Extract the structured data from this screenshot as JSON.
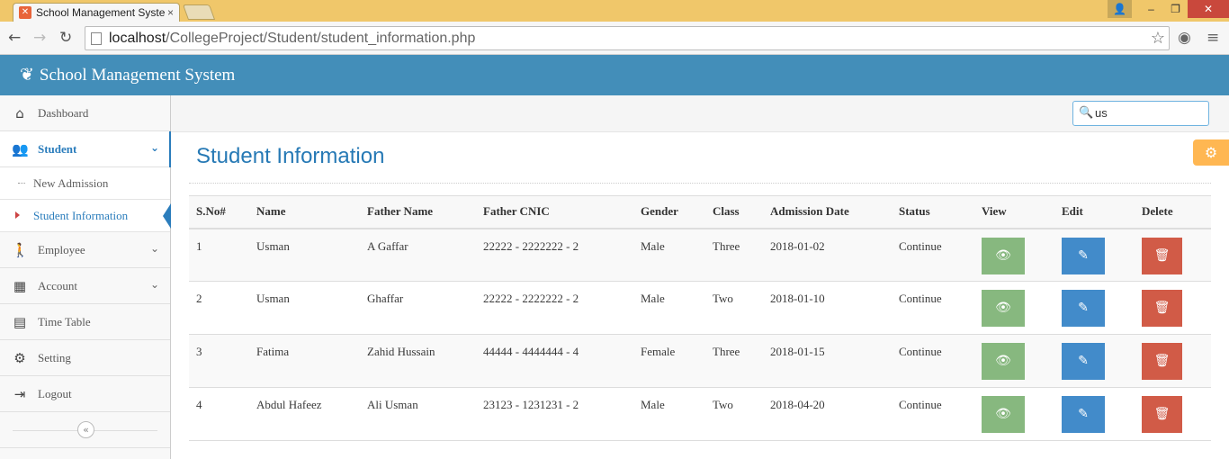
{
  "browser": {
    "tab_title": "School Management Syste",
    "tab_close": "×",
    "url_host": "localhost",
    "url_path": "/CollegeProject/Student/student_information.php"
  },
  "app": {
    "brand": "School Management System"
  },
  "sidebar": {
    "items": [
      {
        "label": "Dashboard",
        "icon": "home-icon"
      },
      {
        "label": "Student",
        "icon": "users-icon",
        "active": true
      },
      {
        "label": "Employee",
        "icon": "employee-icon"
      },
      {
        "label": "Account",
        "icon": "calculator-icon"
      },
      {
        "label": "Time Table",
        "icon": "calendar-icon"
      },
      {
        "label": "Setting",
        "icon": "cog-icon"
      },
      {
        "label": "Logout",
        "icon": "logout-icon"
      }
    ],
    "student_sub": [
      {
        "label": "New Admission"
      },
      {
        "label": "Student Information",
        "current": true
      }
    ]
  },
  "search": {
    "value": "us"
  },
  "page": {
    "title": "Student Information"
  },
  "table": {
    "columns": [
      "S.No#",
      "Name",
      "Father Name",
      "Father CNIC",
      "Gender",
      "Class",
      "Admission Date",
      "Status",
      "View",
      "Edit",
      "Delete"
    ],
    "rows": [
      {
        "sno": "1",
        "name": "Usman",
        "father": "A Gaffar",
        "cnic": "22222 - 2222222 - 2",
        "gender": "Male",
        "class": "Three",
        "date": "2018-01-02",
        "status": "Continue"
      },
      {
        "sno": "2",
        "name": "Usman",
        "father": "Ghaffar",
        "cnic": "22222 - 2222222 - 2",
        "gender": "Male",
        "class": "Two",
        "date": "2018-01-10",
        "status": "Continue"
      },
      {
        "sno": "3",
        "name": "Fatima",
        "father": "Zahid Hussain",
        "cnic": "44444 - 4444444 - 4",
        "gender": "Female",
        "class": "Three",
        "date": "2018-01-15",
        "status": "Continue"
      },
      {
        "sno": "4",
        "name": "Abdul Hafeez",
        "father": "Ali Usman",
        "cnic": "23123 - 1231231 - 2",
        "gender": "Male",
        "class": "Two",
        "date": "2018-04-20",
        "status": "Continue"
      }
    ]
  },
  "colors": {
    "header": "#438eb9",
    "accent": "#2b7dbc",
    "view": "#87b87f",
    "edit": "#428bca",
    "delete": "#d15b47",
    "settings": "#ffb752"
  }
}
